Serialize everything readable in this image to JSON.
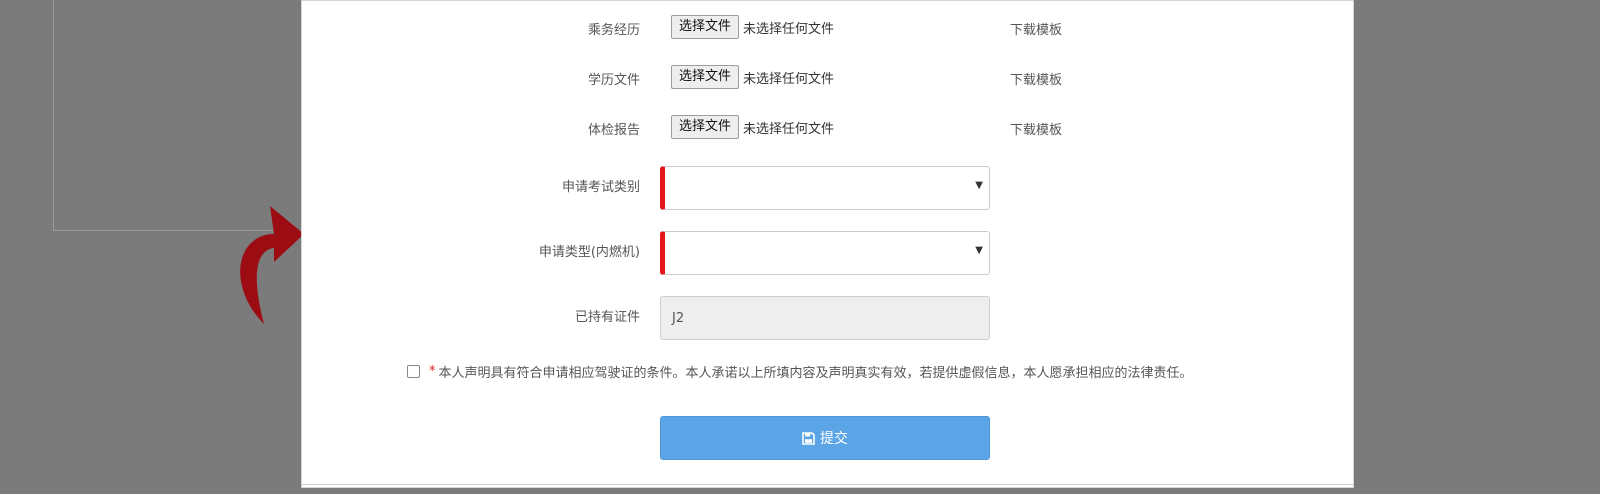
{
  "form": {
    "file_rows": [
      {
        "label": "乘务经历",
        "button": "选择文件",
        "status": "未选择任何文件",
        "download": "下载模板"
      },
      {
        "label": "学历文件",
        "button": "选择文件",
        "status": "未选择任何文件",
        "download": "下载模板"
      },
      {
        "label": "体检报告",
        "button": "选择文件",
        "status": "未选择任何文件",
        "download": "下载模板"
      }
    ],
    "exam_category": {
      "label": "申请考试类别",
      "value": ""
    },
    "apply_type": {
      "label": "申请类型(内燃机)",
      "value": ""
    },
    "held_cert": {
      "label": "已持有证件",
      "value": "J2"
    },
    "agreement": {
      "star": "*",
      "text": "本人声明具有符合申请相应驾驶证的条件。本人承诺以上所填内容及声明真实有效，若提供虚假信息，本人愿承担相应的法律责任。",
      "checked": false
    },
    "submit": {
      "label": "提交",
      "icon": "save-icon"
    }
  },
  "colors": {
    "required_accent": "#e3161b",
    "submit_bg": "#5ba4e5",
    "overlay_bg": "#7b7b7b",
    "arrow": "#9b0d12"
  }
}
